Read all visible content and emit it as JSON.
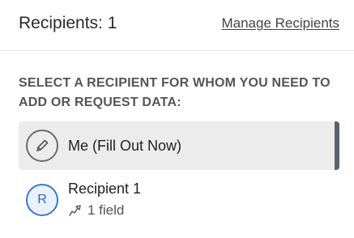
{
  "header": {
    "title": "Recipients: 1",
    "manage_link": "Manage Recipients"
  },
  "instruction": "SELECT A RECIPIENT FOR WHOM YOU NEED TO ADD OR REQUEST DATA:",
  "options": [
    {
      "label": "Me (Fill Out Now)",
      "icon": "pencil-icon",
      "selected": true
    },
    {
      "label": "Recipient 1",
      "avatar_letter": "R",
      "sub_icon": "send-arrow-icon",
      "sub_text": "1 field",
      "selected": false
    }
  ],
  "colors": {
    "accent": "#3d7ac7",
    "selected_bg": "#ececec",
    "selected_bar": "#5a6270"
  }
}
